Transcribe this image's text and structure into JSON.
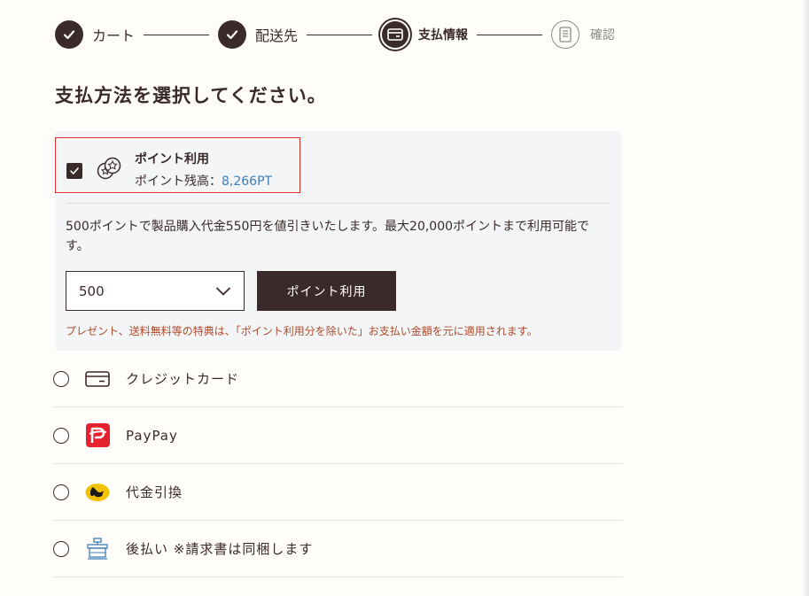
{
  "stepper": {
    "steps": [
      {
        "label": "カート",
        "state": "done",
        "icon": "check-icon"
      },
      {
        "label": "配送先",
        "state": "done",
        "icon": "check-icon"
      },
      {
        "label": "支払情報",
        "state": "current",
        "icon": "card-icon"
      },
      {
        "label": "確認",
        "state": "todo",
        "icon": "document-icon"
      }
    ]
  },
  "heading": "支払方法を選択してください。",
  "points": {
    "checked": true,
    "title": "ポイント利用",
    "balance_label": "ポイント残高：",
    "balance_value": "8,266PT",
    "description": "500ポイントで製品購入代金550円を値引きいたします。最大20,000ポイントまで利用可能です。",
    "select_value": "500",
    "apply_label": "ポイント利用",
    "note": "プレゼント、送料無料等の特典は、「ポイント利用分を除いた」お支払い金額を元に適用されます。"
  },
  "payment_methods": [
    {
      "label": "クレジットカード",
      "icon": "credit-card-icon"
    },
    {
      "label": "PayPay",
      "icon": "paypay-icon"
    },
    {
      "label": "代金引換",
      "icon": "yamato-icon"
    },
    {
      "label": "後払い ※請求書は同梱します",
      "icon": "convenience-store-icon"
    }
  ],
  "colors": {
    "brand": "#3b2a2a",
    "link": "#3d7eb8",
    "note": "#b04a2a",
    "highlight": "#e03030",
    "paypay": "#e5202f",
    "yamato": "#f2c200"
  }
}
